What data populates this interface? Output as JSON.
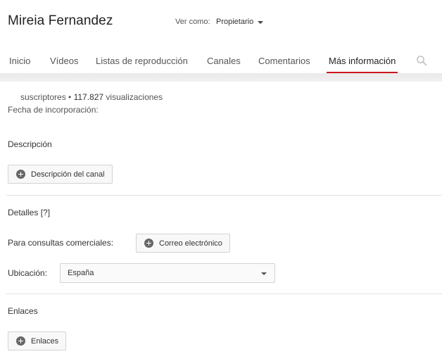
{
  "channel": {
    "name": "Mireia Fernandez"
  },
  "view_as": {
    "label": "Ver como:",
    "value": "Propietario"
  },
  "tabs": [
    {
      "label": "Inicio"
    },
    {
      "label": "Vídeos"
    },
    {
      "label": "Listas de reproducción"
    },
    {
      "label": "Canales"
    },
    {
      "label": "Comentarios"
    },
    {
      "label": "Más información"
    }
  ],
  "icons": {
    "search": "search-icon",
    "add": "plus-circle-icon",
    "dropdown": "caret-down-icon"
  },
  "colors": {
    "active_tab_underline": "#cc181e"
  },
  "about": {
    "stats_prefix": "suscriptores • ",
    "views_count": "117.827",
    "views_label": " visualizaciones",
    "joined_label": "Fecha de incorporación:"
  },
  "description": {
    "title": "Descripción",
    "button_label": "Descripción del canal"
  },
  "details": {
    "title": "Detalles [?]",
    "business_label": "Para consultas comerciales:",
    "email_button": "Correo electrónico",
    "location_label": "Ubicación:",
    "location_value": "España"
  },
  "links": {
    "title": "Enlaces",
    "button_label": "Enlaces"
  }
}
